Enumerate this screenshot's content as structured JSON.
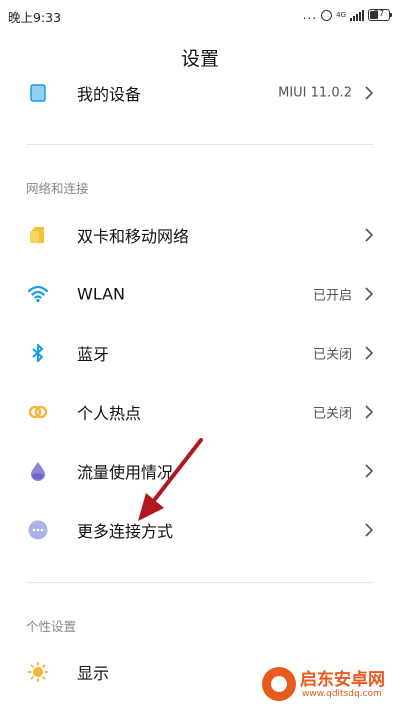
{
  "status_bar": {
    "time": "晚上9:33",
    "dots": "...",
    "network": "4G",
    "battery": "27"
  },
  "title": "设置",
  "top_item": {
    "label": "我的设备",
    "value": "MIUI 11.0.2"
  },
  "sections": {
    "network": "网络和连接",
    "personal": "个性设置"
  },
  "network_items": [
    {
      "label": "双卡和移动网络",
      "value": ""
    },
    {
      "label": "WLAN",
      "value": "已开启"
    },
    {
      "label": "蓝牙",
      "value": "已关闭"
    },
    {
      "label": "个人热点",
      "value": "已关闭"
    },
    {
      "label": "流量使用情况",
      "value": ""
    },
    {
      "label": "更多连接方式",
      "value": ""
    }
  ],
  "personal_items": [
    {
      "label": "显示",
      "value": ""
    }
  ],
  "watermark": {
    "text": "启东安卓网",
    "url": "www.qdltsdq.com"
  },
  "colors": {
    "blue": "#1a9be8",
    "yellow": "#f3c233",
    "purple": "#8b86d8",
    "lilac": "#aab4e6",
    "sun": "#f3b532",
    "arrow": "#b0181d"
  }
}
